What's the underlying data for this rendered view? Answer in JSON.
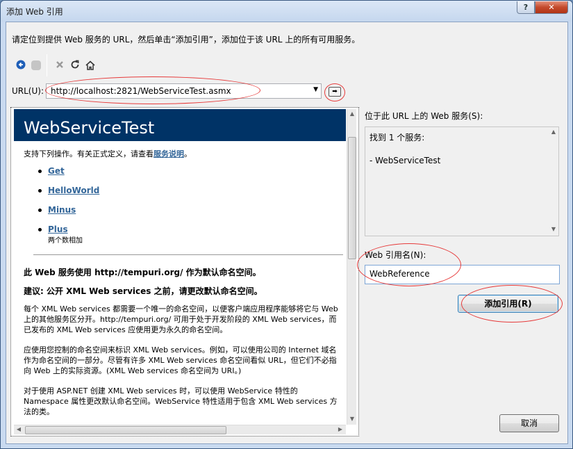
{
  "window": {
    "title": "添加 Web 引用",
    "help_button": "?",
    "close_button": "✕"
  },
  "instruction": "请定位到提供 Web 服务的 URL，然后单击“添加引用”，添加位于该 URL 上的所有可用服务。",
  "toolbar": {
    "back_icon": "back-arrow-icon",
    "stop_icon": "stop-icon",
    "cancel_icon": "x-icon",
    "refresh_icon": "refresh-icon",
    "home_icon": "home-icon"
  },
  "url": {
    "label": "URL(U):",
    "value": "http://localhost:2821/WebServiceTest.asmx"
  },
  "browser": {
    "page_title": "WebServiceTest",
    "intro": "支持下列操作。有关正式定义，请查看",
    "intro_link": "服务说明",
    "intro_end": "。",
    "operations": [
      {
        "name": "Get",
        "desc": ""
      },
      {
        "name": "HelloWorld",
        "desc": ""
      },
      {
        "name": "Minus",
        "desc": ""
      },
      {
        "name": "Plus",
        "desc": "两个数相加"
      }
    ],
    "heading1": "此 Web 服务使用 http://tempuri.org/ 作为默认命名空间。",
    "heading2": "建议: 公开 XML Web services 之前，请更改默认命名空间。",
    "para1": "每个 XML Web services 都需要一个唯一的命名空间，以便客户端应用程序能够将它与 Web 上的其他服务区分开。http://tempuri.org/ 可用于处于开发阶段的 XML Web services，而已发布的 XML Web services 应使用更为永久的命名空间。",
    "para2": "应使用您控制的命名空间来标识 XML Web services。例如，可以使用公司的 Internet 域名作为命名空间的一部分。尽管有许多 XML Web services 命名空间看似 URL，但它们不必指向 Web 上的实际资源。(XML Web services 命名空间为 URI。)",
    "para3": "对于使用 ASP.NET 创建 XML Web services 时，可以使用 WebService 特性的 Namespace 属性更改默认命名空间。WebService 特性适用于包含 XML Web services 方法的类。"
  },
  "services": {
    "label": "位于此 URL 上的 Web 服务(S):",
    "found": "找到 1 个服务:",
    "items": [
      "- WebServiceTest"
    ]
  },
  "reference": {
    "label": "Web 引用名(N):",
    "value": "WebReference"
  },
  "buttons": {
    "add": "添加引用(R)",
    "cancel": "取消"
  },
  "colors": {
    "header_bg": "#003366",
    "link": "#336699",
    "annotation": "#e63a3a"
  }
}
